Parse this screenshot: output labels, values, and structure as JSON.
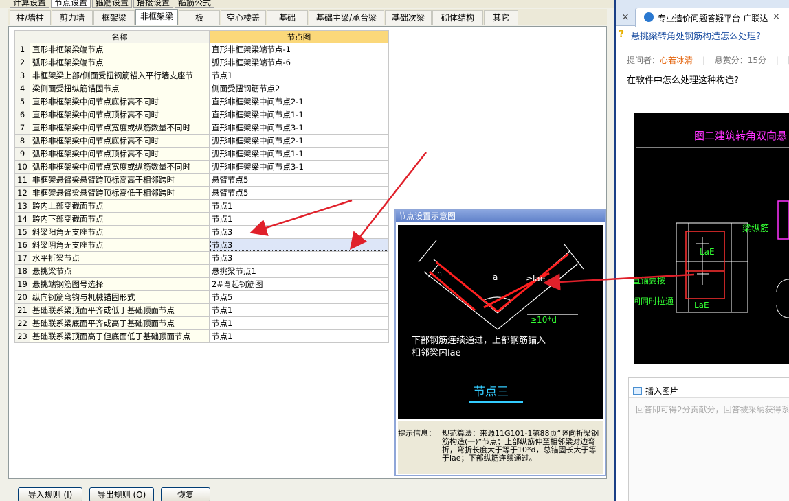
{
  "top_tabs": [
    "计算设置",
    "节点设置",
    "箍筋设置",
    "搭接设置",
    "箍筋公式"
  ],
  "category_tabs": [
    "柱/墙柱",
    "剪力墙",
    "框架梁",
    "非框架梁",
    "板",
    "空心楼盖",
    "基础",
    "基础主梁/承台梁",
    "基础次梁",
    "砌体结构",
    "其它"
  ],
  "table": {
    "headers": [
      "名称",
      "节点图"
    ],
    "rows": [
      {
        "no": "1",
        "name": "直形非框架梁端节点",
        "node": "直形非框架梁端节点-1"
      },
      {
        "no": "2",
        "name": "弧形非框架梁端节点",
        "node": "弧形非框架梁端节点-6"
      },
      {
        "no": "3",
        "name": "非框架梁上部/侧面受扭钢筋锚入平行墙支座节",
        "node": "节点1"
      },
      {
        "no": "4",
        "name": "梁侧面受扭纵筋锚固节点",
        "node": "侧面受扭钢筋节点2"
      },
      {
        "no": "5",
        "name": "直形非框架梁中间节点底标高不同时",
        "node": "直形非框架梁中间节点2-1"
      },
      {
        "no": "6",
        "name": "直形非框架梁中间节点顶标高不同时",
        "node": "直形非框架梁中间节点1-1"
      },
      {
        "no": "7",
        "name": "直形非框架梁中间节点宽度或纵筋数量不同时",
        "node": "直形非框架梁中间节点3-1"
      },
      {
        "no": "8",
        "name": "弧形非框架梁中间节点底标高不同时",
        "node": "弧形非框架梁中间节点2-1"
      },
      {
        "no": "9",
        "name": "弧形非框架梁中间节点顶标高不同时",
        "node": "弧形非框架梁中间节点1-1"
      },
      {
        "no": "10",
        "name": "弧形非框架梁中间节点宽度或纵筋数量不同时",
        "node": "弧形非框架梁中间节点3-1"
      },
      {
        "no": "11",
        "name": "非框架悬臂梁悬臂跨顶标高高于相邻跨时",
        "node": "悬臂节点5"
      },
      {
        "no": "12",
        "name": "非框架悬臂梁悬臂跨顶标高低于相邻跨时",
        "node": "悬臂节点5"
      },
      {
        "no": "13",
        "name": "跨内上部变截面节点",
        "node": "节点1"
      },
      {
        "no": "14",
        "name": "跨内下部变截面节点",
        "node": "节点1"
      },
      {
        "no": "15",
        "name": "斜梁阳角无支座节点",
        "node": "节点3"
      },
      {
        "no": "16",
        "name": "斜梁阴角无支座节点",
        "node": "节点3"
      },
      {
        "no": "17",
        "name": "水平折梁节点",
        "node": "节点3"
      },
      {
        "no": "18",
        "name": "悬挑梁节点",
        "node": "悬挑梁节点1"
      },
      {
        "no": "19",
        "name": "悬挑端钢筋图号选择",
        "node": "2#弯起钢筋图"
      },
      {
        "no": "20",
        "name": "纵向钢筋弯钩与机械锚固形式",
        "node": "节点5"
      },
      {
        "no": "21",
        "name": "基础联系梁顶面平齐或低于基础顶面节点",
        "node": "节点1"
      },
      {
        "no": "22",
        "name": "基础联系梁底面平齐或高于基础顶面节点",
        "node": "节点1"
      },
      {
        "no": "23",
        "name": "基础联系梁顶面高于但底面低于基础顶面节点",
        "node": "节点1"
      }
    ]
  },
  "preview": {
    "title": "节点设置示意图",
    "label_a": "a",
    "label_h": "h",
    "label_lae": "≥lae",
    "label_10d": "≥10*d",
    "caption_line1": "下部钢筋连续通过，上部钢筋锚入",
    "caption_line2": "相邻梁内lae",
    "node_name": "节点三",
    "hint_label": "提示信息：",
    "hint_text": "规范算法：来源11G101-1第88页“竖向折梁钢筋构造(一)”节点；上部纵筋伸至相邻梁对边弯折，弯折长度大于等于10*d，总锚固长大于等于lae；下部纵筋连续通过。"
  },
  "buttons": {
    "import": "导入规则 (I)",
    "export": "导出规则 (O)",
    "restore": "恢复"
  },
  "browser": {
    "tab_title": "专业造价问题答疑平台-广联达",
    "question_title": "悬挑梁转角处钢筋构造怎么处理?",
    "meta_asker_label": "提问者：",
    "meta_asker": "心若冰清",
    "meta_reward": "悬赏分：15分",
    "meta_more": "回",
    "question_body": "在软件中怎么处理这种构造?",
    "cad_title": "图二建筑转角双向悬",
    "cad_label_rebar": "梁纵筋",
    "cad_label_le1": "LaE",
    "cad_label_le2": "LaE",
    "cad_label_anchor": "直锚要按",
    "cad_label_simul": "间同时拉通",
    "insert_picture": "插入图片",
    "answer_placeholder": "回答即可得2分贡献分，回答被采纳获得系"
  },
  "colors": {
    "accent": "#1e50a2",
    "node_header": "#fbd87a",
    "selected_row": "#dde6f8",
    "arrow": "#e0202a",
    "cad_magenta": "#ff33ff",
    "cad_green": "#33ff33"
  }
}
